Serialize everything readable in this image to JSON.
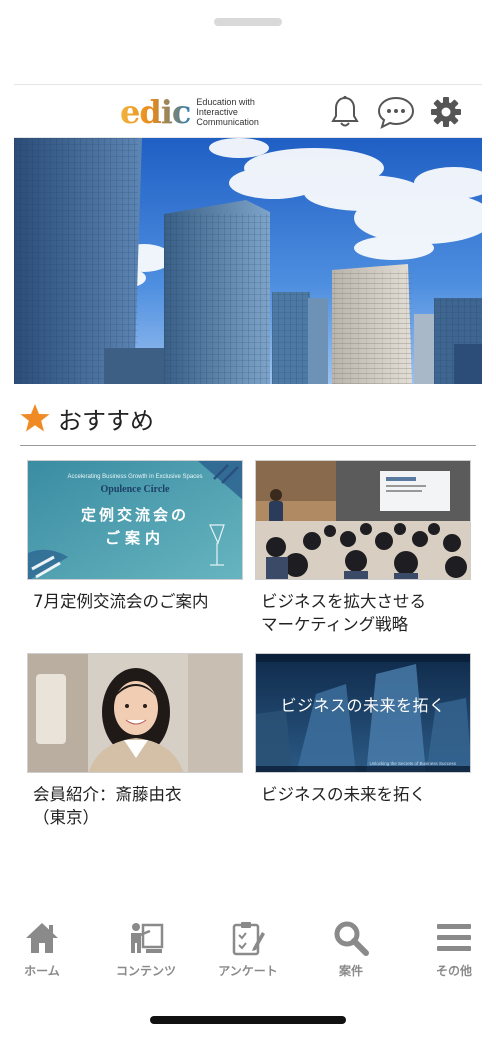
{
  "header": {
    "logo_word": "edic",
    "logo_tagline": [
      "Education with",
      "Interactive",
      "Communication"
    ],
    "icons": [
      "bell-icon",
      "chat-bubble-icon",
      "gear-icon"
    ]
  },
  "hero": {
    "image": "office-skyscrapers-blue-sky"
  },
  "section": {
    "icon": "star-icon",
    "title": "おすすめ"
  },
  "cards": [
    {
      "image": "opulence-circle-banner",
      "thumb_subtitle": "Accelerating Business Growth in Exclusive Spaces",
      "thumb_brand": "Opulence Circle",
      "thumb_title_1": "定例交流会の",
      "thumb_title_2": "ご案内",
      "caption": "7月定例交流会のご案内"
    },
    {
      "image": "seminar-audience-photo",
      "caption": "ビジネスを拡大させる\nマーケティング戦略"
    },
    {
      "image": "member-portrait-photo",
      "caption": "会員紹介：斎藤由衣\n（東京）"
    },
    {
      "image": "future-business-banner",
      "thumb_title": "ビジネスの未来を拓く",
      "thumb_footer": "Unlocking the Secrets of Business Success",
      "caption": "ビジネスの未来を拓く"
    }
  ],
  "tabs": [
    {
      "icon": "home-icon",
      "label": "ホーム"
    },
    {
      "icon": "presenter-icon",
      "label": "コンテンツ"
    },
    {
      "icon": "clipboard-icon",
      "label": "アンケート"
    },
    {
      "icon": "search-icon",
      "label": "案件"
    },
    {
      "icon": "menu-icon",
      "label": "その他"
    }
  ],
  "colors": {
    "accent_star": "#f08a24",
    "tab_icon": "#8a8a8a",
    "logo_orange": "#e88a1a",
    "logo_blue": "#2f7fb3"
  }
}
